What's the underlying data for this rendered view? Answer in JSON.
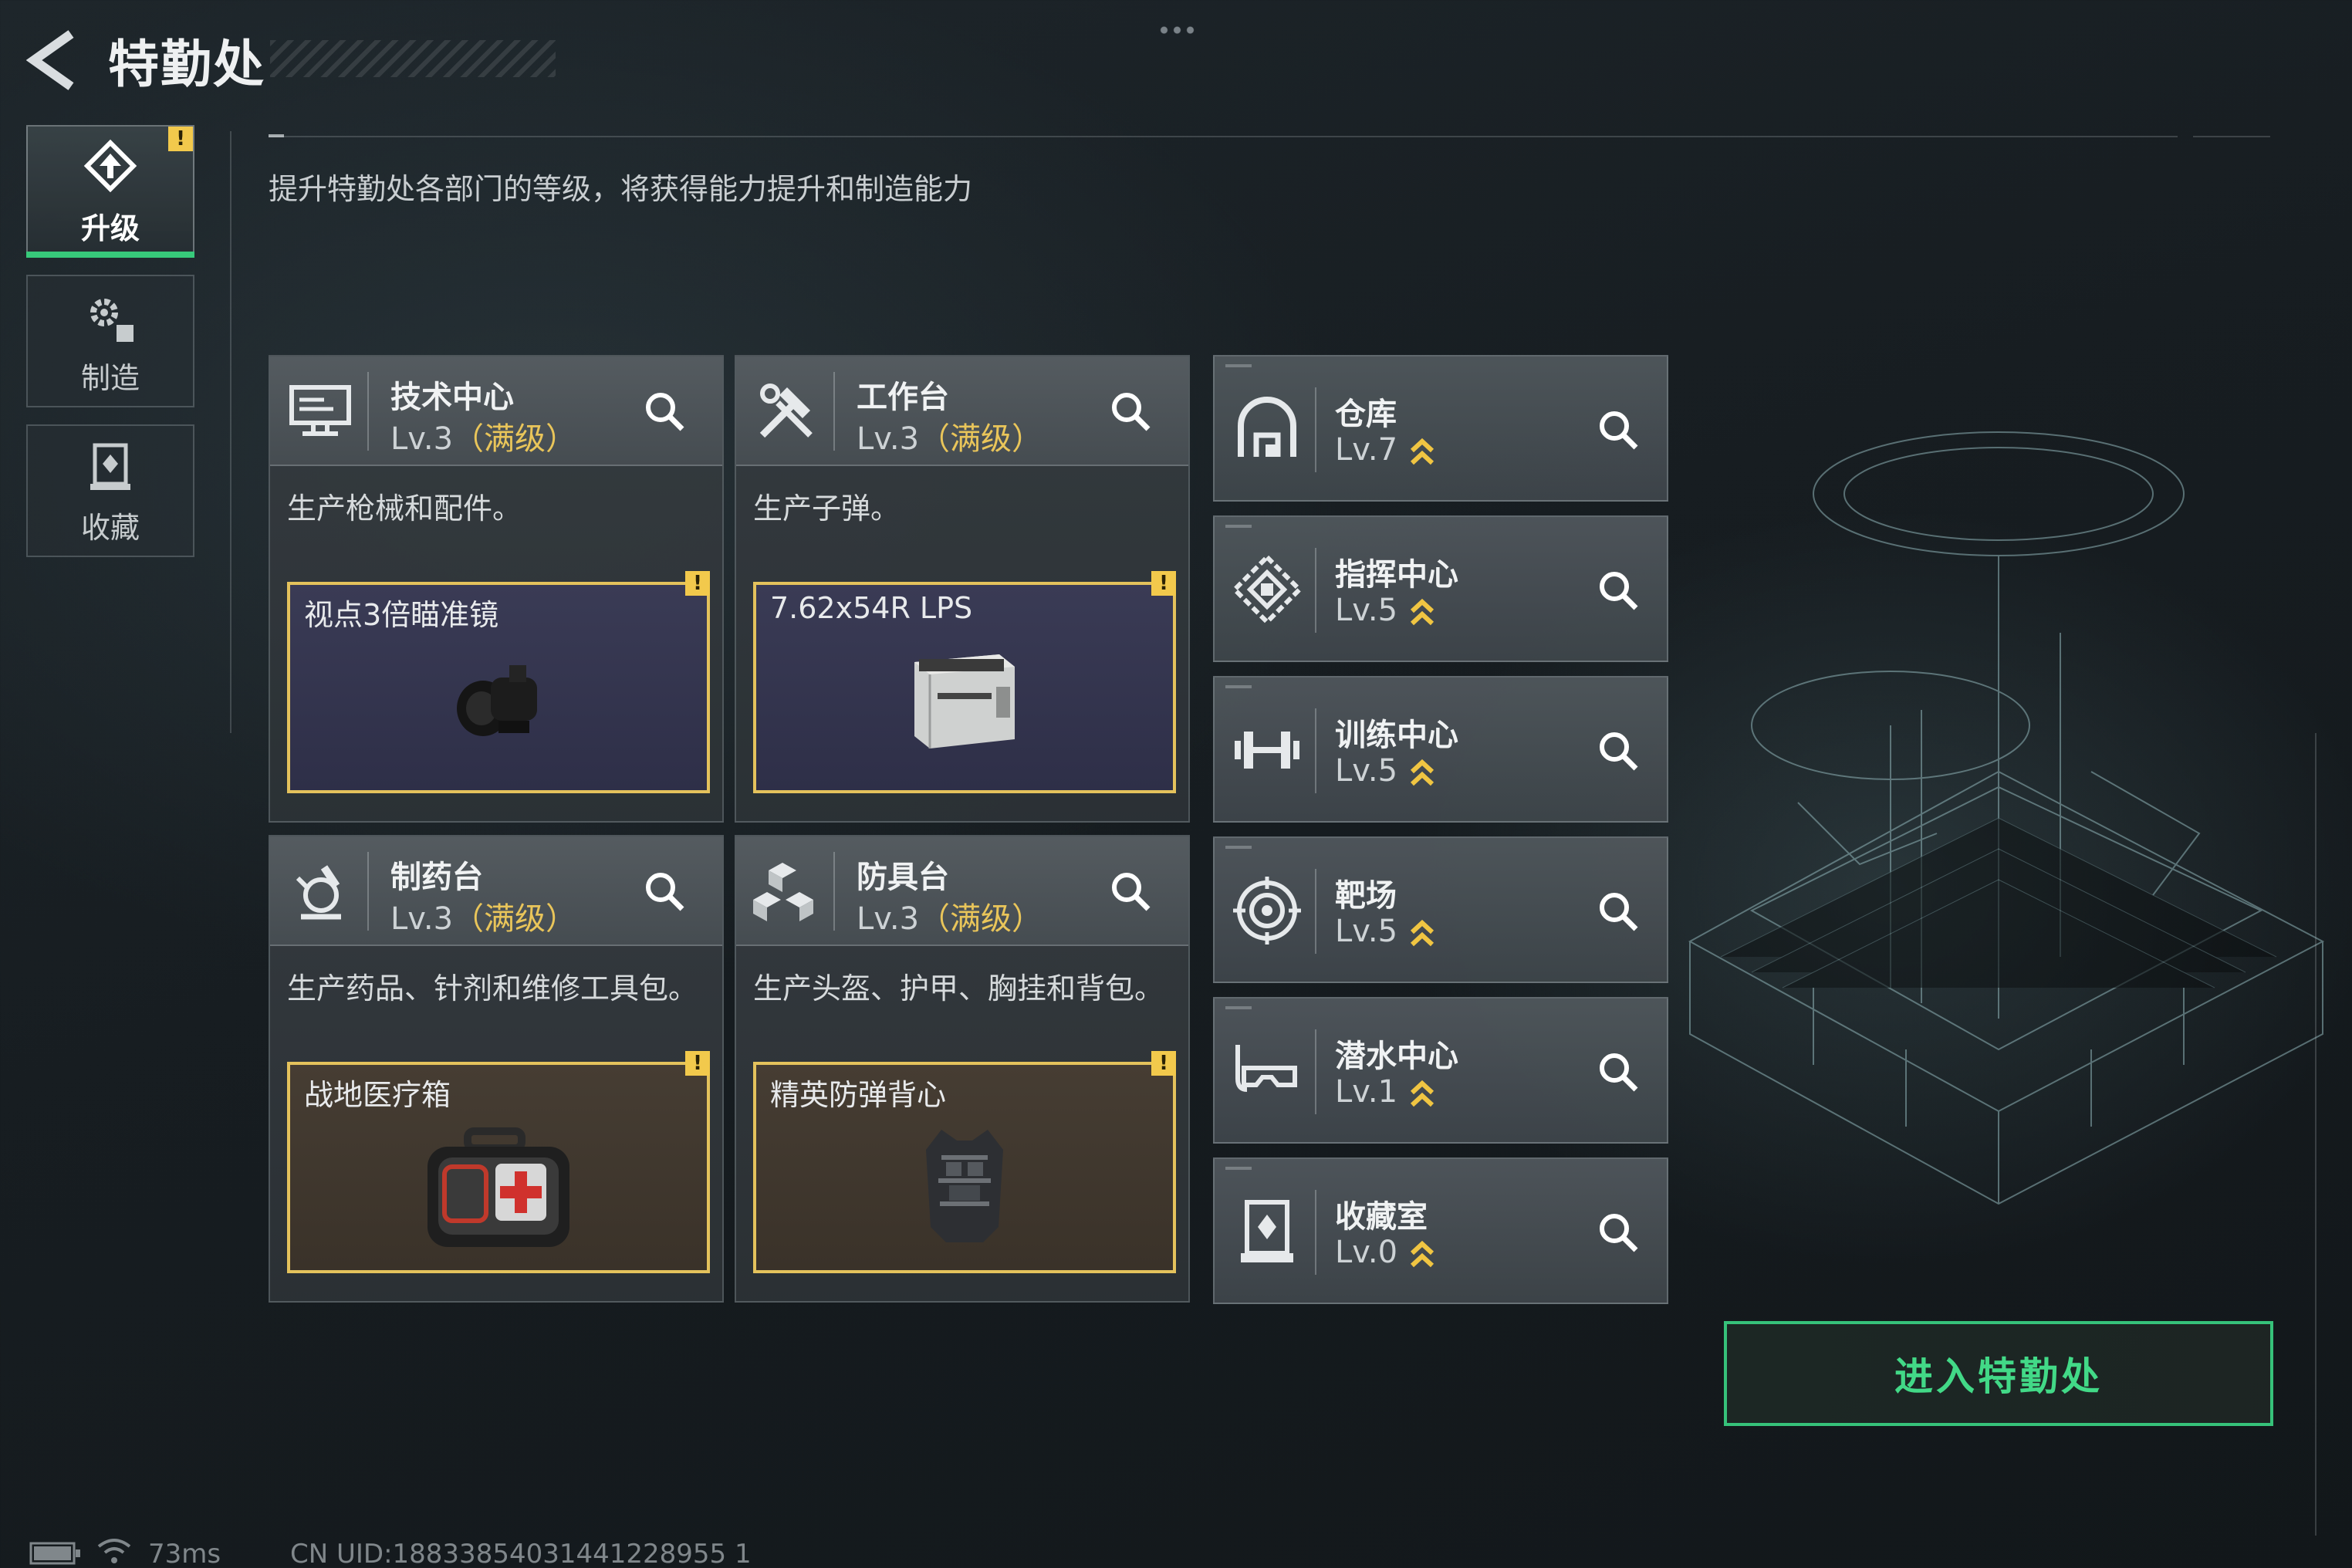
{
  "header": {
    "title": "特勤处"
  },
  "nav": {
    "tabs": [
      {
        "label": "升级",
        "active": true,
        "alert": "!"
      },
      {
        "label": "制造",
        "active": false
      },
      {
        "label": "收藏",
        "active": false
      }
    ]
  },
  "subtitle": "提升特勤处各部门的等级，将获得能力提升和制造能力",
  "departments": [
    {
      "name": "技术中心",
      "level": "Lv.3",
      "max_tag": "（满级）",
      "desc": "生产枪械和配件。",
      "item": {
        "name": "视点3倍瞄准镜",
        "alert": "!",
        "rarity": "purple"
      },
      "icon": "monitor-icon"
    },
    {
      "name": "工作台",
      "level": "Lv.3",
      "max_tag": "（满级）",
      "desc": "生产子弹。",
      "item": {
        "name": "7.62x54R LPS",
        "alert": "!",
        "rarity": "purple"
      },
      "icon": "tools-icon"
    },
    {
      "name": "制药台",
      "level": "Lv.3",
      "max_tag": "（满级）",
      "desc": "生产药品、针剂和维修工具包。",
      "item": {
        "name": "战地医疗箱",
        "alert": "!",
        "rarity": "gold"
      },
      "icon": "microscope-icon"
    },
    {
      "name": "防具台",
      "level": "Lv.3",
      "max_tag": "（满级）",
      "desc": "生产头盔、护甲、胸挂和背包。",
      "item": {
        "name": "精英防弹背心",
        "alert": "!",
        "rarity": "gold"
      },
      "icon": "armor-blocks-icon"
    }
  ],
  "facilities": [
    {
      "name": "仓库",
      "level": "Lv.7",
      "icon": "warehouse-icon"
    },
    {
      "name": "指挥中心",
      "level": "Lv.5",
      "icon": "command-icon"
    },
    {
      "name": "训练中心",
      "level": "Lv.5",
      "icon": "dumbbell-icon"
    },
    {
      "name": "靶场",
      "level": "Lv.5",
      "icon": "target-icon"
    },
    {
      "name": "潜水中心",
      "level": "Lv.1",
      "icon": "diving-mask-icon"
    },
    {
      "name": "收藏室",
      "level": "Lv.0",
      "icon": "collection-icon"
    }
  ],
  "enter_button": "进入特勤处",
  "status": {
    "ping": "73ms",
    "uid": "CN UID:18833854031441228955 1"
  },
  "colors": {
    "accent_green": "#37c97a",
    "alert_yellow": "#f2c94c",
    "max_gold": "#e9c55a",
    "upgrade_arrow": "#f0c542"
  }
}
